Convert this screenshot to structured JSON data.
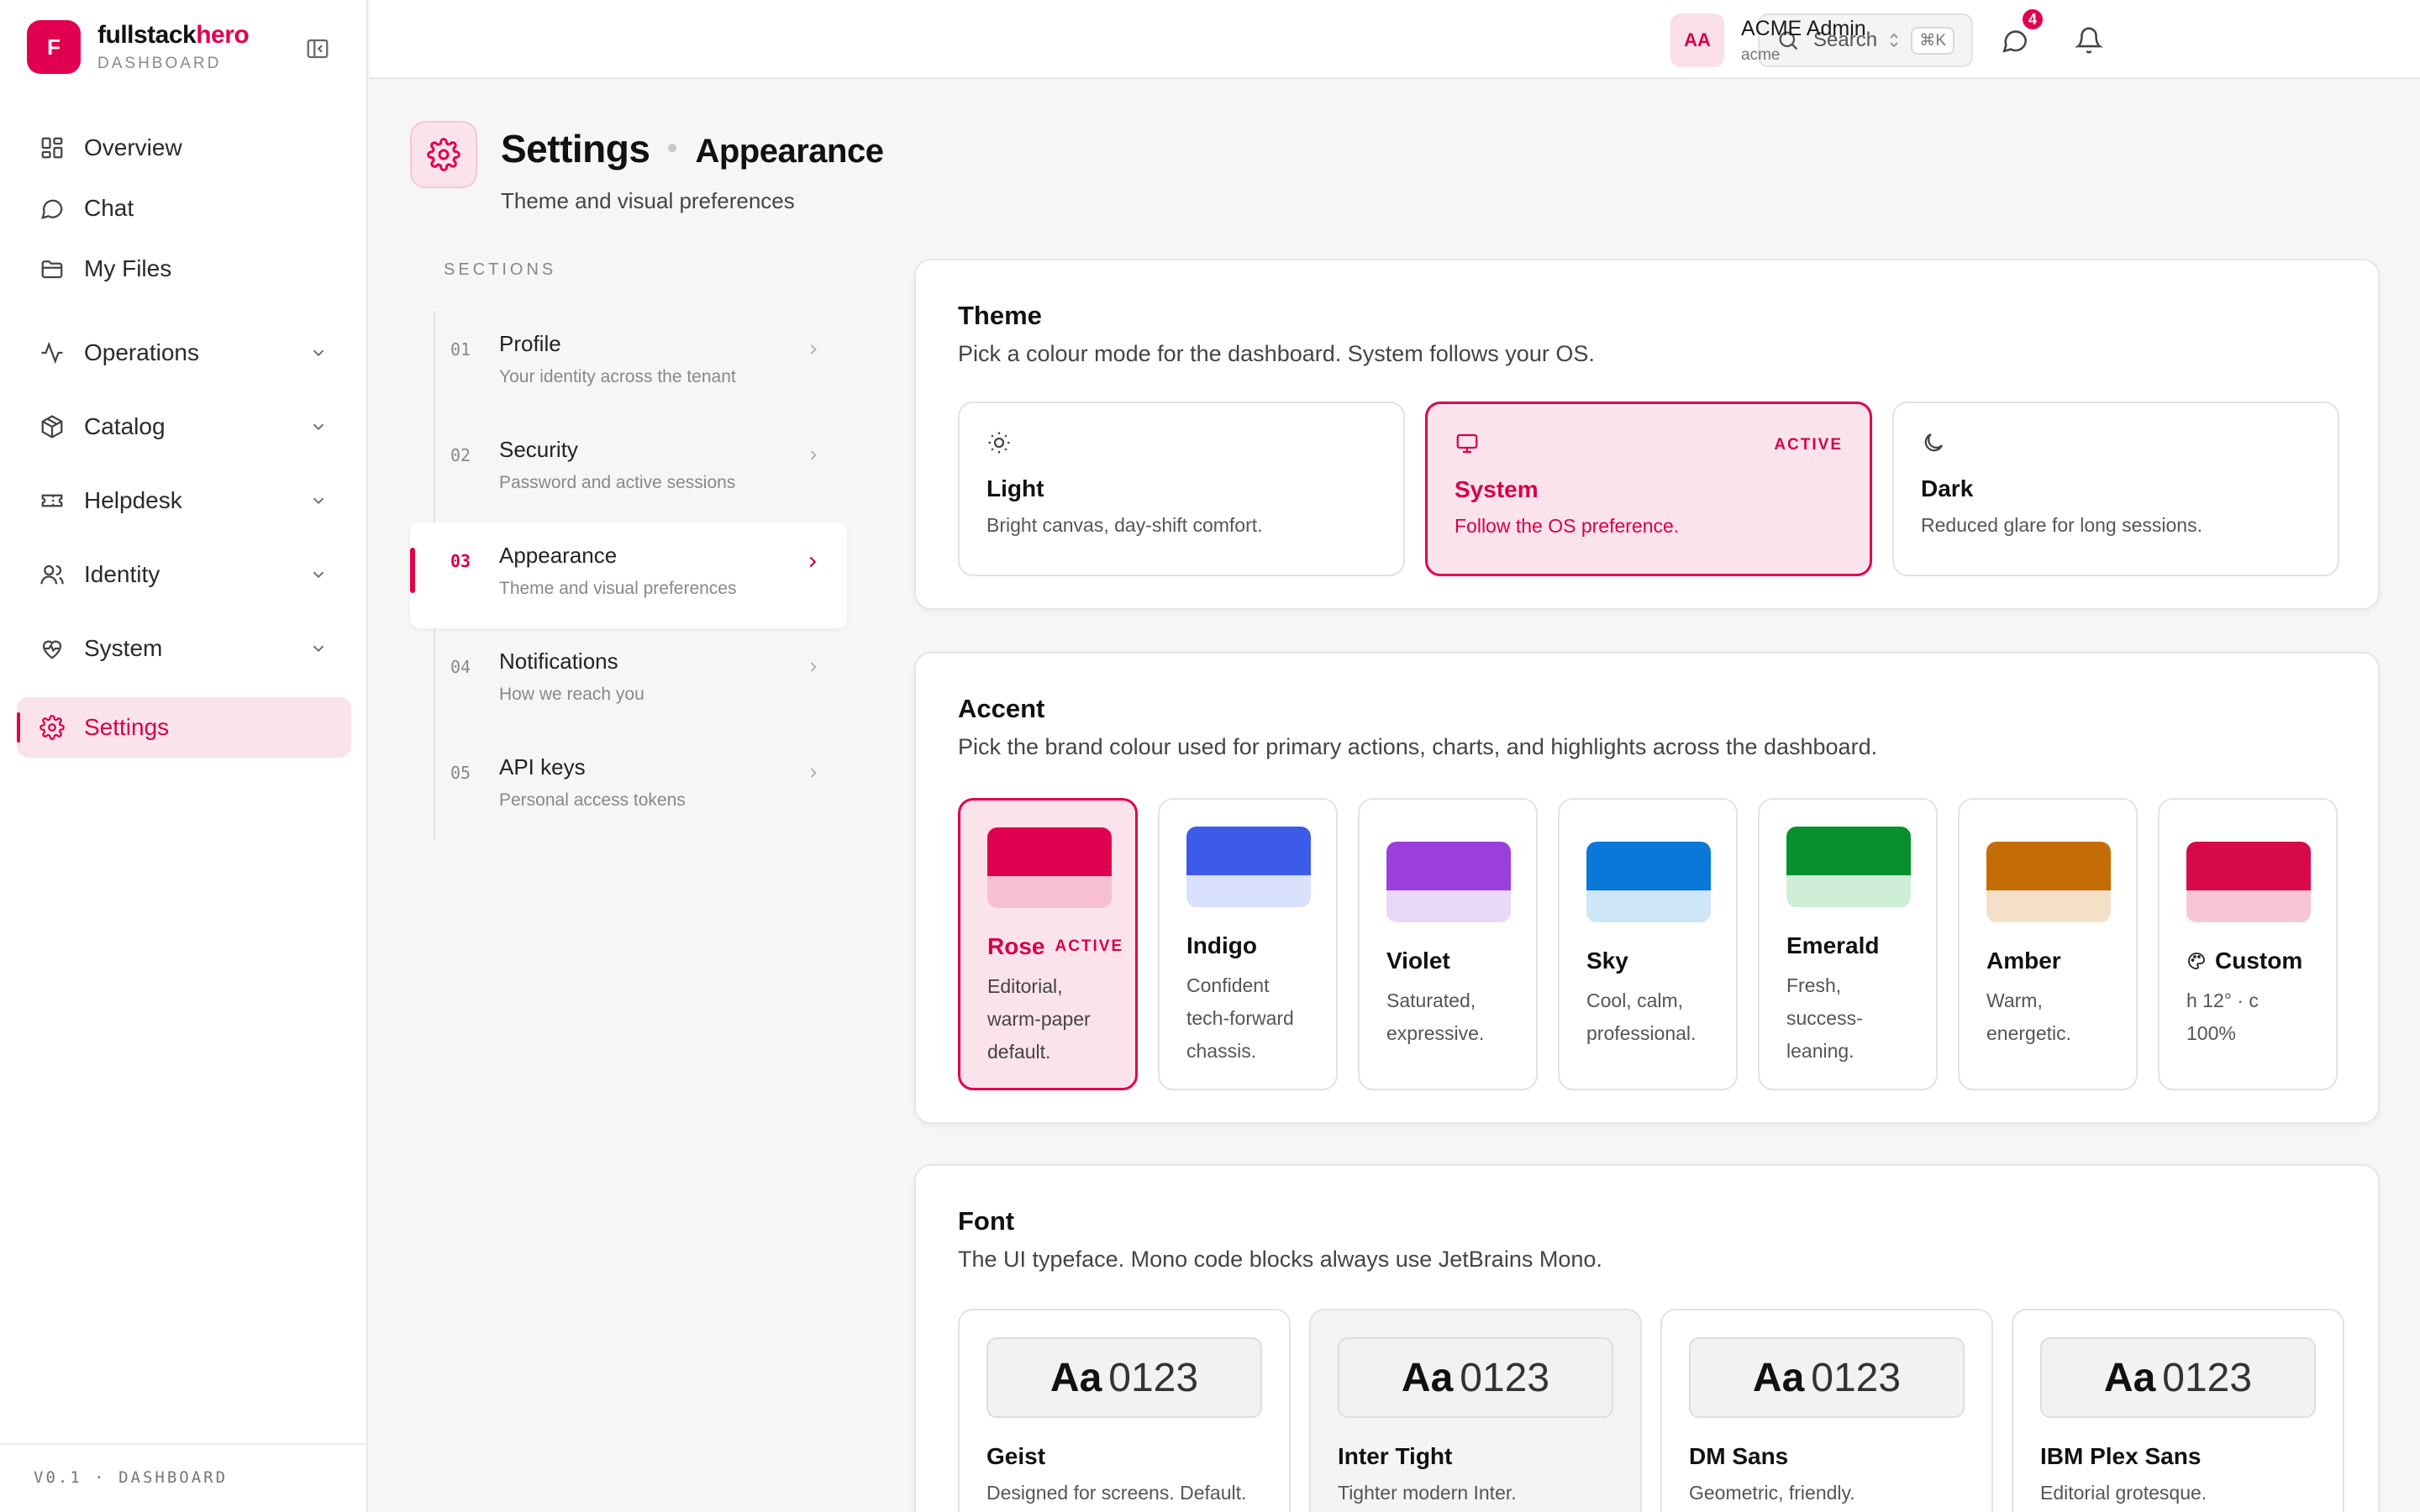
{
  "brand": {
    "logo_letter": "F",
    "name_main": "fullstack",
    "name_accent": "hero",
    "subtitle": "DASHBOARD"
  },
  "nav": {
    "overview": "Overview",
    "chat": "Chat",
    "files": "My Files",
    "operations": "Operations",
    "catalog": "Catalog",
    "helpdesk": "Helpdesk",
    "identity": "Identity",
    "system": "System",
    "settings": "Settings"
  },
  "footer": {
    "version": "V0.1 · DASHBOARD"
  },
  "topbar": {
    "search_label": "Search",
    "search_shortcut": "⌘K",
    "chat_badge": "4",
    "user_initials": "AA",
    "user_name": "ACME Admin",
    "user_org": "acme"
  },
  "page": {
    "title": "Settings",
    "section": "Appearance",
    "subtitle": "Theme and visual preferences"
  },
  "sections": {
    "label": "SECTIONS",
    "items": [
      {
        "num": "01",
        "title": "Profile",
        "desc": "Your identity across the tenant"
      },
      {
        "num": "02",
        "title": "Security",
        "desc": "Password and active sessions"
      },
      {
        "num": "03",
        "title": "Appearance",
        "desc": "Theme and visual preferences"
      },
      {
        "num": "04",
        "title": "Notifications",
        "desc": "How we reach you"
      },
      {
        "num": "05",
        "title": "API keys",
        "desc": "Personal access tokens"
      }
    ]
  },
  "theme": {
    "title": "Theme",
    "subtitle": "Pick a colour mode for the dashboard. System follows your OS.",
    "active_label": "ACTIVE",
    "options": [
      {
        "name": "Light",
        "desc": "Bright canvas, day-shift comfort.",
        "icon": "sun-icon"
      },
      {
        "name": "System",
        "desc": "Follow the OS preference.",
        "icon": "monitor-icon"
      },
      {
        "name": "Dark",
        "desc": "Reduced glare for long sessions.",
        "icon": "moon-icon"
      }
    ]
  },
  "accent": {
    "title": "Accent",
    "subtitle": "Pick the brand colour used for primary actions, charts, and highlights across the dashboard.",
    "active_label": "ACTIVE",
    "options": [
      {
        "name": "Rose",
        "desc": "Editorial, warm-paper default.",
        "color": "#e0004f",
        "tint": "#f6bfd2"
      },
      {
        "name": "Indigo",
        "desc": "Confident tech-forward chassis.",
        "color": "#3b5be8",
        "tint": "#d9e0fb"
      },
      {
        "name": "Violet",
        "desc": "Saturated, expressive.",
        "color": "#9a3fdc",
        "tint": "#ead8f8"
      },
      {
        "name": "Sky",
        "desc": "Cool, calm, professional.",
        "color": "#0a78d8",
        "tint": "#cfe5f8"
      },
      {
        "name": "Emerald",
        "desc": "Fresh, success-leaning.",
        "color": "#07902c",
        "tint": "#cfeed8"
      },
      {
        "name": "Amber",
        "desc": "Warm, energetic.",
        "color": "#c46c06",
        "tint": "#f4e0c8"
      },
      {
        "name": "Custom",
        "desc": "h 12° · c 100%",
        "color": "#d80a4a",
        "tint": "#f6c6d4"
      }
    ]
  },
  "font": {
    "title": "Font",
    "subtitle": "The UI typeface. Mono code blocks always use JetBrains Mono.",
    "preview_aa": "Aa",
    "preview_num": "0123",
    "options": [
      {
        "name": "Geist",
        "desc": "Designed for screens. Default."
      },
      {
        "name": "Inter Tight",
        "desc": "Tighter modern Inter."
      },
      {
        "name": "DM Sans",
        "desc": "Geometric, friendly."
      },
      {
        "name": "IBM Plex Sans",
        "desc": "Editorial grotesque."
      }
    ]
  }
}
